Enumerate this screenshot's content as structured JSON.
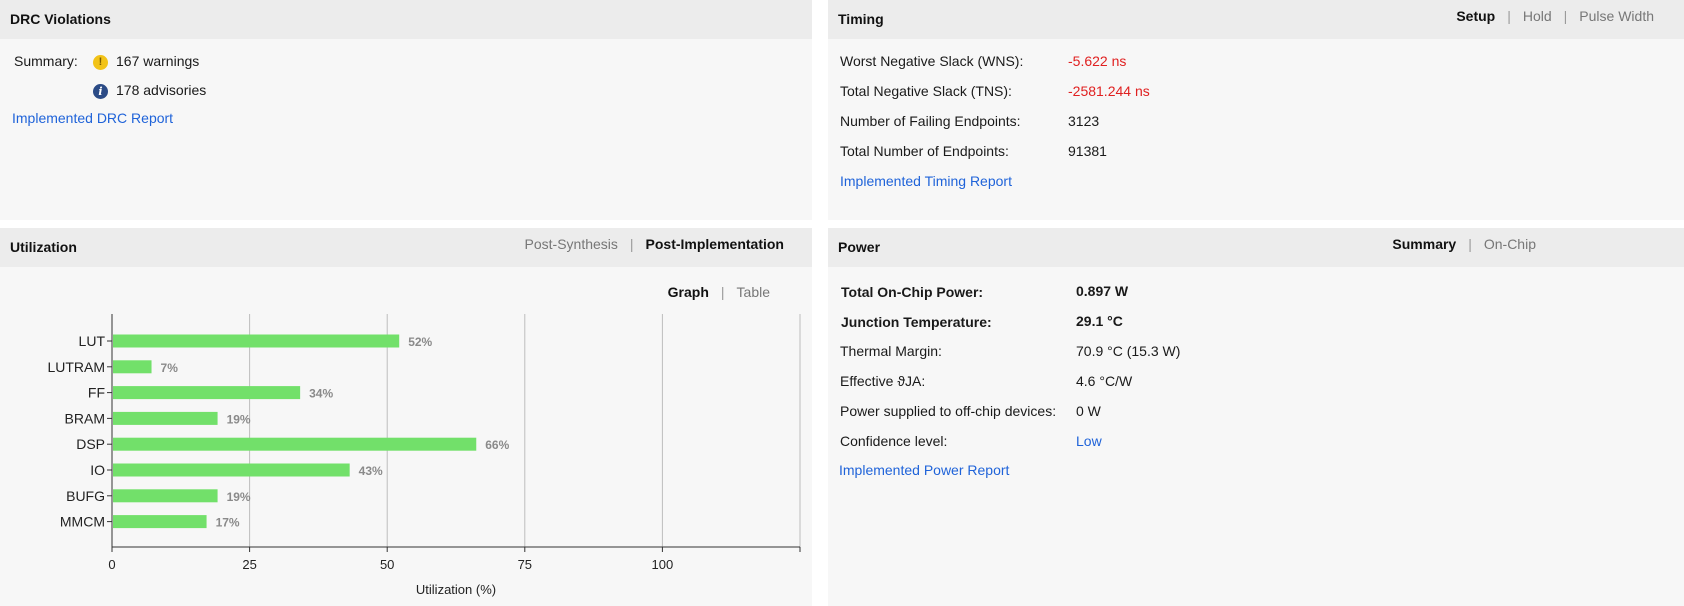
{
  "drc": {
    "title": "DRC Violations",
    "summary_label": "Summary:",
    "warnings_text": "167 warnings",
    "advisories_text": "178 advisories",
    "report_link": "Implemented DRC Report",
    "warn_icon_glyph": "!",
    "info_icon_glyph": "i",
    "warn_icon_name": "warning-icon",
    "info_icon_name": "info-icon"
  },
  "timing": {
    "title": "Timing",
    "tabs": [
      "Setup",
      "Hold",
      "Pulse Width"
    ],
    "active_tab": "Setup",
    "rows": [
      {
        "label": "Worst Negative Slack (WNS):",
        "value": "-5.622 ns"
      },
      {
        "label": "Total Negative Slack (TNS):",
        "value": "-2581.244 ns"
      },
      {
        "label": "Number of Failing Endpoints:",
        "value": "3123"
      },
      {
        "label": "Total Number of Endpoints:",
        "value": "91381"
      }
    ],
    "report_link": "Implemented Timing Report"
  },
  "utilization": {
    "title": "Utilization",
    "tabs": [
      "Post-Synthesis",
      "Post-Implementation"
    ],
    "active_tab": "Post-Implementation",
    "view_tabs": [
      "Graph",
      "Table"
    ],
    "active_view": "Graph"
  },
  "power": {
    "title": "Power",
    "tabs": [
      "Summary",
      "On-Chip"
    ],
    "active_tab": "Summary",
    "rows": [
      {
        "label": "Total On-Chip Power:",
        "value": "0.897 W"
      },
      {
        "label": "Junction Temperature:",
        "value": "29.1 °C"
      },
      {
        "label": "Thermal Margin:",
        "value": "70.9 °C (15.3 W)"
      },
      {
        "label": "Effective ϑJA:",
        "value": "4.6 °C/W"
      },
      {
        "label": "Power supplied to off-chip devices:",
        "value": "0 W"
      },
      {
        "label": "Confidence level:",
        "value": "Low"
      }
    ],
    "report_link": "Implemented Power Report"
  },
  "colors": {
    "bar": "#72e06a",
    "negative": "#e02020",
    "link": "#1f63d9",
    "grid": "#bdbdbd"
  },
  "chart_data": {
    "type": "bar",
    "orientation": "horizontal",
    "categories": [
      "LUT",
      "LUTRAM",
      "FF",
      "BRAM",
      "DSP",
      "IO",
      "BUFG",
      "MMCM"
    ],
    "values": [
      52,
      7,
      34,
      19,
      66,
      43,
      19,
      17
    ],
    "value_labels": [
      "52%",
      "7%",
      "34%",
      "19%",
      "66%",
      "43%",
      "19%",
      "17%"
    ],
    "xlabel": "Utilization (%)",
    "ylabel": "",
    "xlim": [
      0,
      125
    ],
    "xticks": [
      0,
      25,
      50,
      75,
      100
    ],
    "xtick_labels": [
      "0",
      "25",
      "50",
      "75",
      "100"
    ],
    "grid": true
  }
}
